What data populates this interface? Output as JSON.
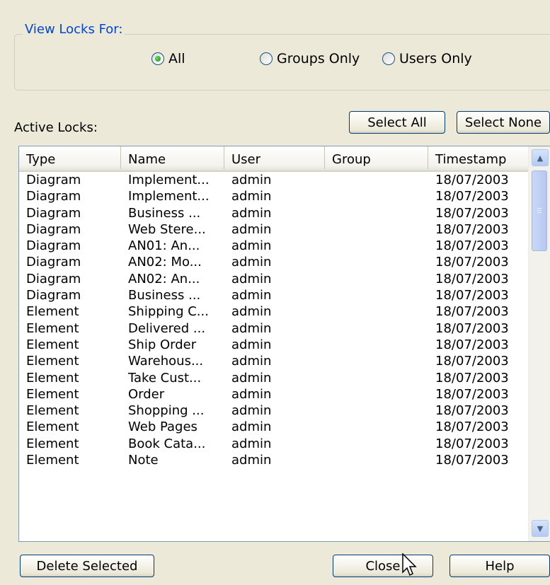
{
  "view_locks": {
    "title": "View Locks For:",
    "options": [
      {
        "label": "All",
        "checked": true
      },
      {
        "label": "Groups Only",
        "checked": false
      },
      {
        "label": "Users Only",
        "checked": false
      }
    ]
  },
  "active_locks_label": "Active Locks:",
  "buttons": {
    "select_all": "Select All",
    "select_none": "Select None",
    "delete_selected": "Delete Selected",
    "close": "Close",
    "help": "Help"
  },
  "table": {
    "columns": [
      "Type",
      "Name",
      "User",
      "Group",
      "Timestamp"
    ],
    "rows": [
      [
        "Diagram",
        "Implement...",
        "admin",
        "",
        "18/07/2003"
      ],
      [
        "Diagram",
        "Implement...",
        "admin",
        "",
        "18/07/2003"
      ],
      [
        "Diagram",
        "Business ...",
        "admin",
        "",
        "18/07/2003"
      ],
      [
        "Diagram",
        "Web Stere...",
        "admin",
        "",
        "18/07/2003"
      ],
      [
        "Diagram",
        "AN01: An...",
        "admin",
        "",
        "18/07/2003"
      ],
      [
        "Diagram",
        "AN02: Mo...",
        "admin",
        "",
        "18/07/2003"
      ],
      [
        "Diagram",
        "AN02: An...",
        "admin",
        "",
        "18/07/2003"
      ],
      [
        "Diagram",
        "Business ...",
        "admin",
        "",
        "18/07/2003"
      ],
      [
        "Element",
        "Shipping C...",
        "admin",
        "",
        "18/07/2003"
      ],
      [
        "Element",
        "Delivered ...",
        "admin",
        "",
        "18/07/2003"
      ],
      [
        "Element",
        "Ship Order",
        "admin",
        "",
        "18/07/2003"
      ],
      [
        "Element",
        "Warehous...",
        "admin",
        "",
        "18/07/2003"
      ],
      [
        "Element",
        "Take Cust...",
        "admin",
        "",
        "18/07/2003"
      ],
      [
        "Element",
        "Order",
        "admin",
        "",
        "18/07/2003"
      ],
      [
        "Element",
        "Shopping ...",
        "admin",
        "",
        "18/07/2003"
      ],
      [
        "Element",
        "Web Pages",
        "admin",
        "",
        "18/07/2003"
      ],
      [
        "Element",
        "Book Cata...",
        "admin",
        "",
        "18/07/2003"
      ],
      [
        "Element",
        "Note",
        "admin",
        "",
        "18/07/2003"
      ]
    ]
  },
  "icons": {
    "scroll_up": "scroll-up-arrow-icon",
    "scroll_down": "scroll-down-arrow-icon",
    "cursor": "mouse-pointer-icon"
  }
}
